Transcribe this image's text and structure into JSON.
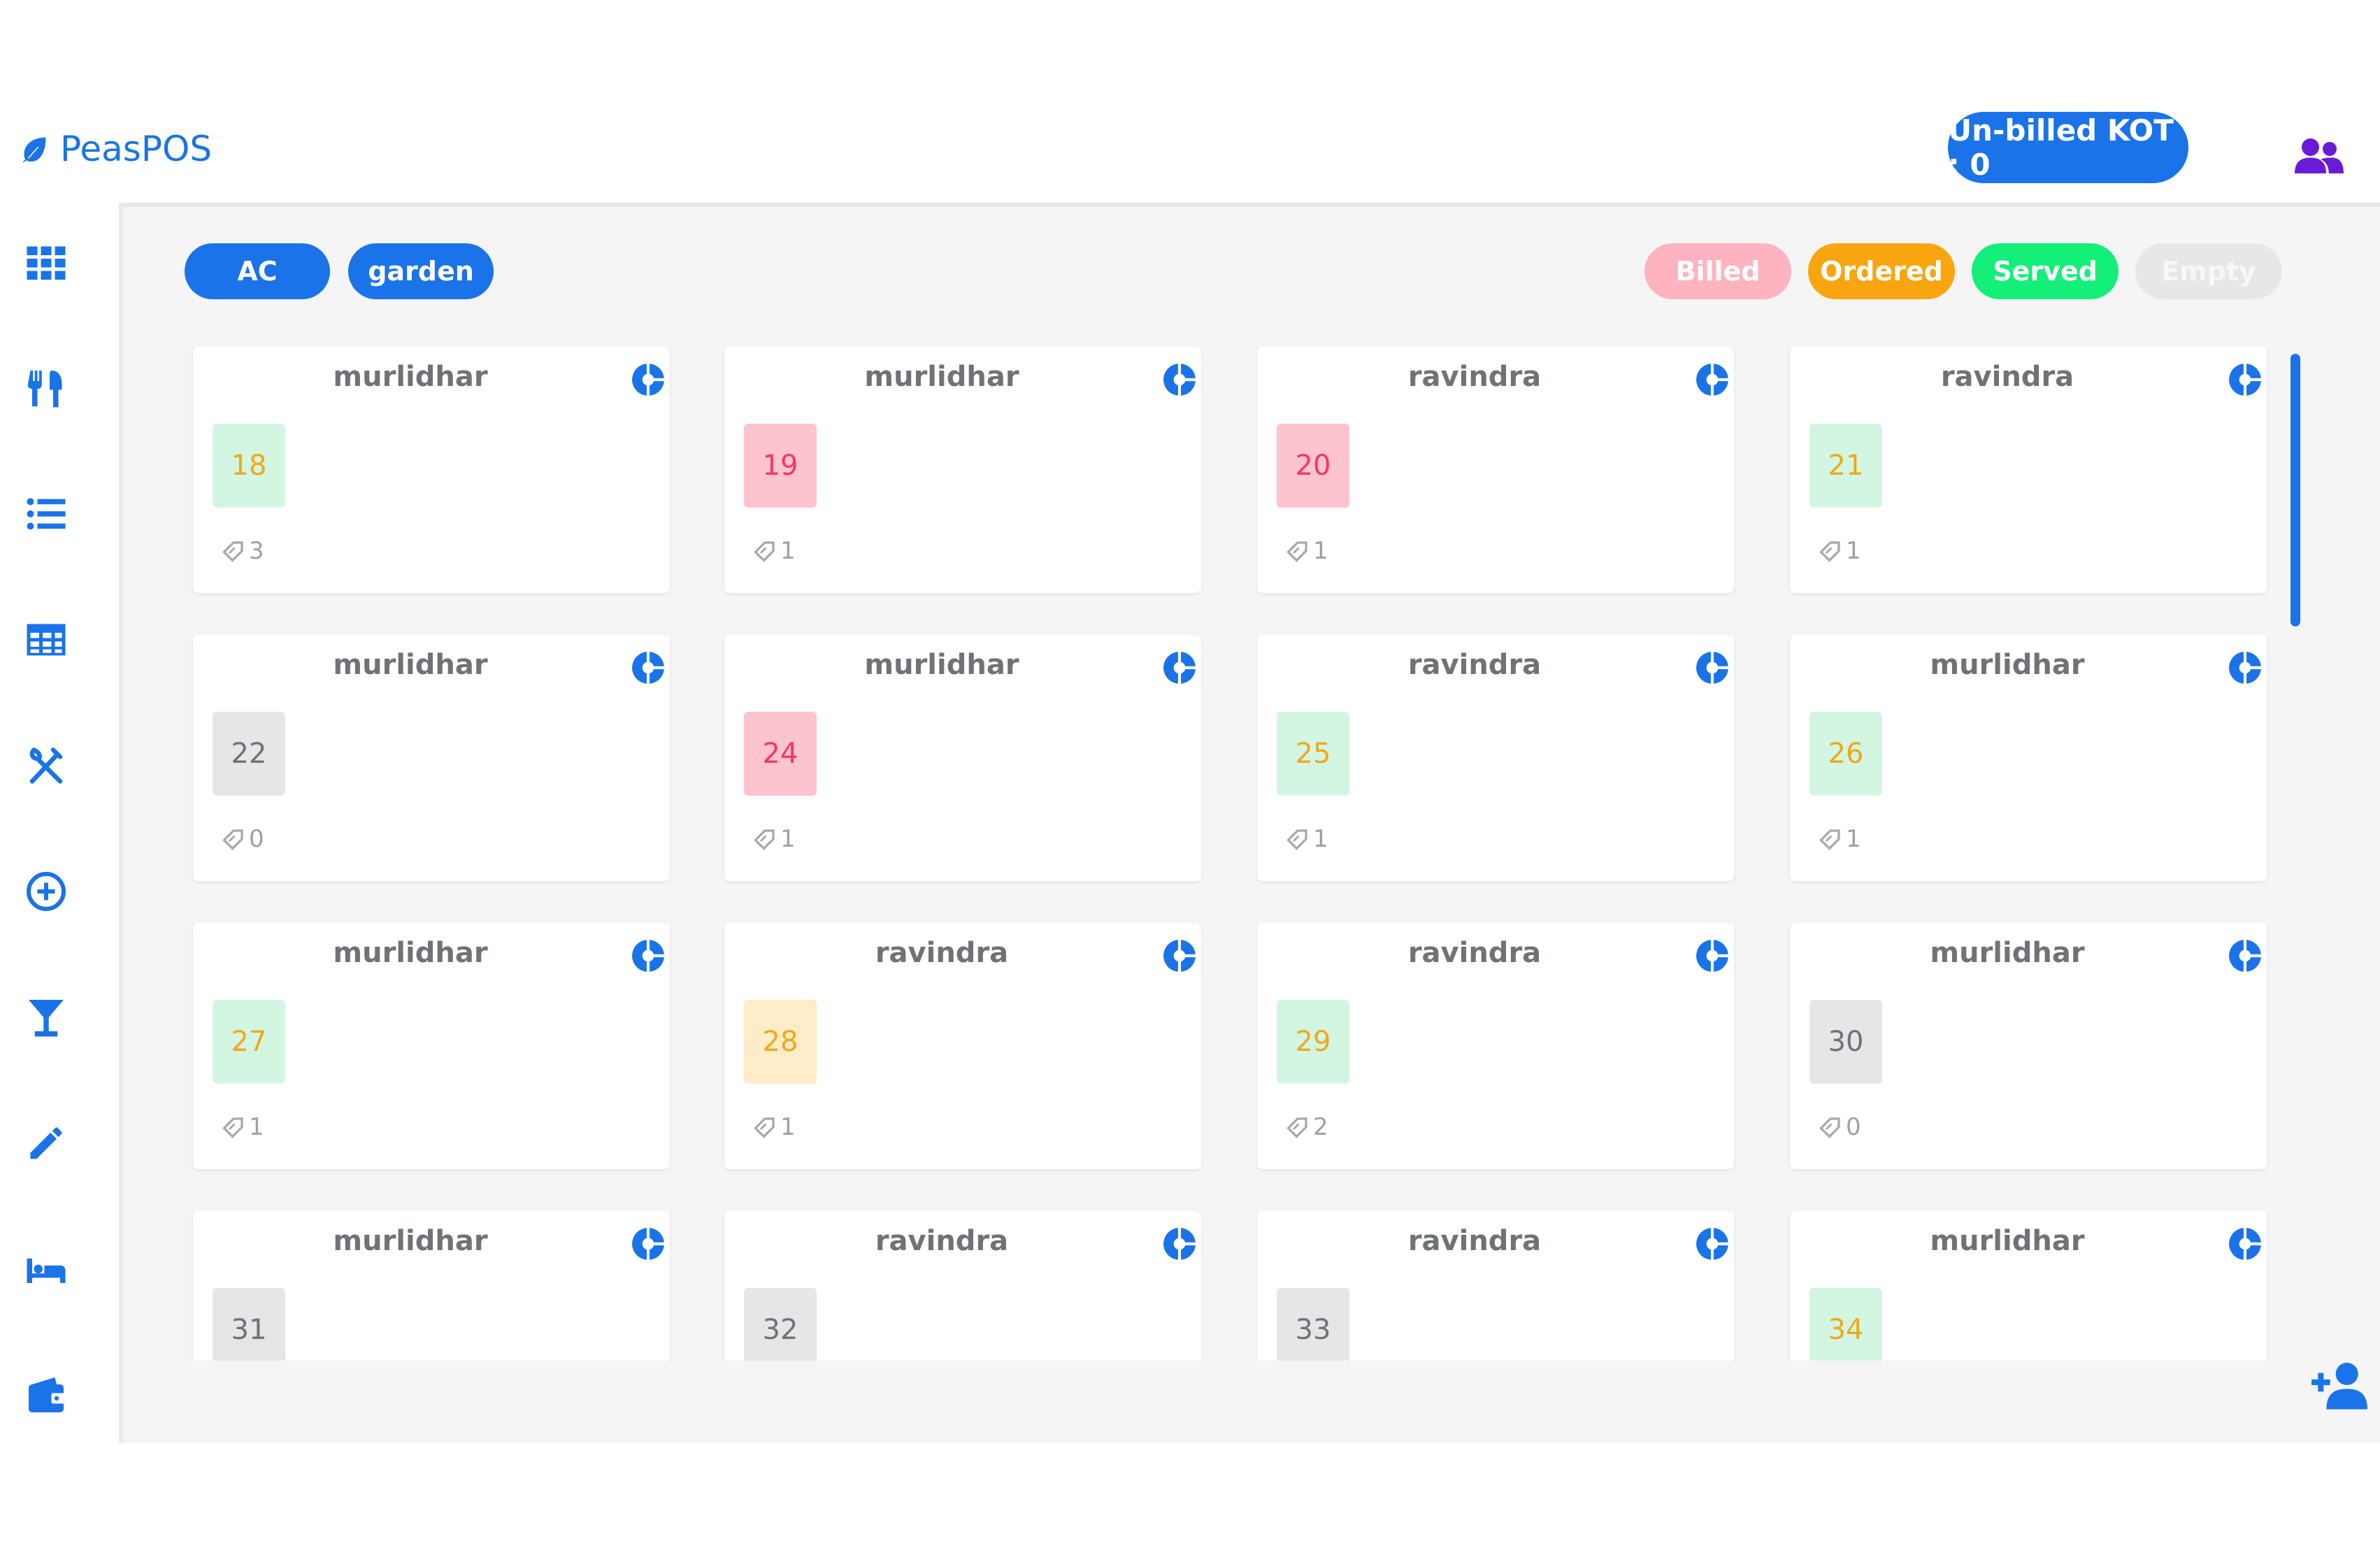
{
  "app": {
    "name": "PeasPOS"
  },
  "header": {
    "kot_label": "Un-billed KOT : 0"
  },
  "colors": {
    "primary": "#1a73e8",
    "users_icon": "#6a1bd6"
  },
  "sidebar": {
    "items": [
      {
        "icon": "grid-icon"
      },
      {
        "icon": "utensils-icon"
      },
      {
        "icon": "list-icon"
      },
      {
        "icon": "table-icon"
      },
      {
        "icon": "fork-knife-crossed-icon"
      },
      {
        "icon": "plus-circle-icon"
      },
      {
        "icon": "cocktail-icon"
      },
      {
        "icon": "pencil-icon"
      },
      {
        "icon": "bed-icon"
      },
      {
        "icon": "wallet-icon"
      }
    ]
  },
  "sections": [
    "AC",
    "garden"
  ],
  "legend": [
    {
      "label": "Billed",
      "color": "#ffb3c0"
    },
    {
      "label": "Ordered",
      "color": "#f9a50f"
    },
    {
      "label": "Served",
      "color": "#14ef79"
    },
    {
      "label": "Empty",
      "color": "#e5e7e9"
    }
  ],
  "status_styles": {
    "served": {
      "bg": "#d3f6e2",
      "fg": "#f0a81a"
    },
    "billed": {
      "bg": "#fdc3ce",
      "fg": "#f13a5e"
    },
    "ordered": {
      "bg": "#ffecc8",
      "fg": "#f0a81a"
    },
    "empty": {
      "bg": "#e4e6e8",
      "fg": "#6f7377"
    }
  },
  "tables": [
    {
      "waiter": "murlidhar",
      "number": "18",
      "count": "3",
      "status": "served"
    },
    {
      "waiter": "murlidhar",
      "number": "19",
      "count": "1",
      "status": "billed"
    },
    {
      "waiter": "ravindra",
      "number": "20",
      "count": "1",
      "status": "billed"
    },
    {
      "waiter": "ravindra",
      "number": "21",
      "count": "1",
      "status": "served"
    },
    {
      "waiter": "murlidhar",
      "number": "22",
      "count": "0",
      "status": "empty"
    },
    {
      "waiter": "murlidhar",
      "number": "24",
      "count": "1",
      "status": "billed"
    },
    {
      "waiter": "ravindra",
      "number": "25",
      "count": "1",
      "status": "served"
    },
    {
      "waiter": "murlidhar",
      "number": "26",
      "count": "1",
      "status": "served"
    },
    {
      "waiter": "murlidhar",
      "number": "27",
      "count": "1",
      "status": "served"
    },
    {
      "waiter": "ravindra",
      "number": "28",
      "count": "1",
      "status": "ordered"
    },
    {
      "waiter": "ravindra",
      "number": "29",
      "count": "2",
      "status": "served"
    },
    {
      "waiter": "murlidhar",
      "number": "30",
      "count": "0",
      "status": "empty"
    },
    {
      "waiter": "murlidhar",
      "number": "31",
      "count": "",
      "status": "empty"
    },
    {
      "waiter": "ravindra",
      "number": "32",
      "count": "",
      "status": "empty"
    },
    {
      "waiter": "ravindra",
      "number": "33",
      "count": "",
      "status": "empty"
    },
    {
      "waiter": "murlidhar",
      "number": "34",
      "count": "",
      "status": "served"
    }
  ]
}
